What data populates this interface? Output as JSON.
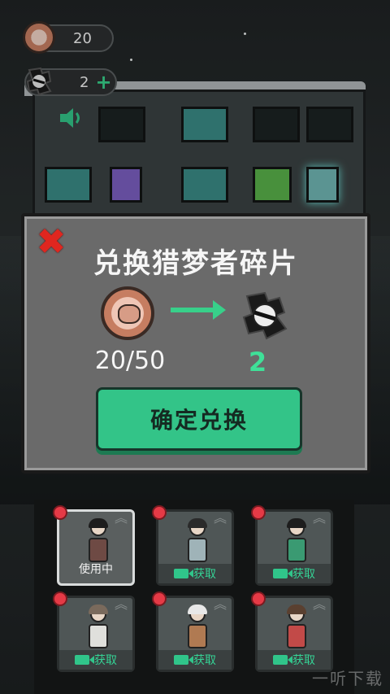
{
  "hud": {
    "coins": "20",
    "fragments": "2",
    "add": "+"
  },
  "dialog": {
    "title": "兑换猎梦者碎片",
    "close": "✖",
    "rate": "20/50",
    "result": "2",
    "confirm_label": "确定兑换"
  },
  "characters": [
    {
      "status": "使用中",
      "active": true,
      "hair": "#1d1d1d",
      "body": "#6e4a44"
    },
    {
      "status": "获取",
      "active": false,
      "hair": "#2a2a2a",
      "body": "#9fb3b8"
    },
    {
      "status": "获取",
      "active": false,
      "hair": "#1d1d1d",
      "body": "#3a9a72"
    },
    {
      "status": "获取",
      "active": false,
      "hair": "#7a6a5c",
      "body": "#e0e0dc"
    },
    {
      "status": "获取",
      "active": false,
      "hair": "#e8e8e8",
      "body": "#b07a52"
    },
    {
      "status": "获取",
      "active": false,
      "hair": "#5a4030",
      "body": "#c24a48"
    }
  ],
  "colors": {
    "accent_green": "#33c488",
    "close_red": "#e0261f",
    "badge_red": "#e53a46"
  },
  "watermark": "一听下载"
}
